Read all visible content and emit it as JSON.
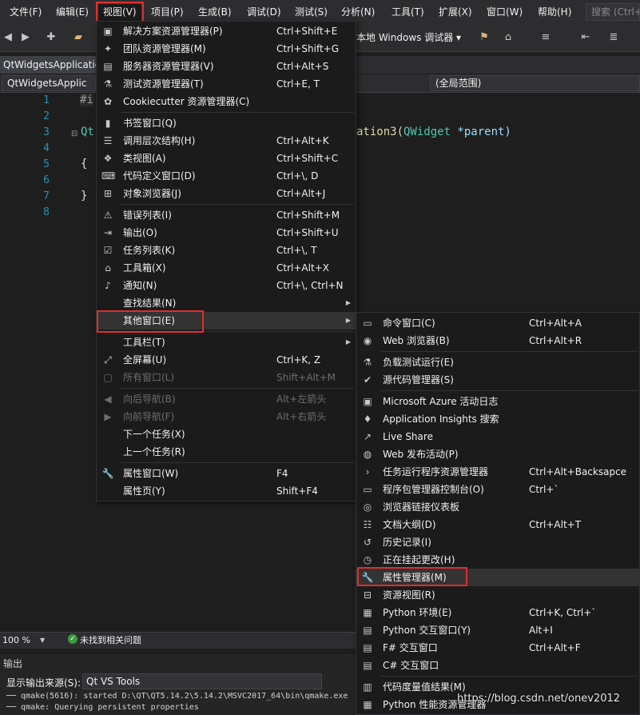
{
  "menubar": {
    "items": [
      "文件(F)",
      "编辑(E)",
      "视图(V)",
      "项目(P)",
      "生成(B)",
      "调试(D)",
      "测试(S)",
      "分析(N)",
      "工具(T)",
      "扩展(X)",
      "窗口(W)",
      "帮助(H)"
    ],
    "search_placeholder": "搜索 (Ctrl+"
  },
  "toolbar": {
    "debugger": "本地 Windows 调试器 ▾"
  },
  "tabs": {
    "doc": "QtWidgetsApplication",
    "nav_left": "QtWidgetsApplic",
    "nav_right": "(全局范围)"
  },
  "editor": {
    "lines": [
      "1",
      "2",
      "3",
      "4",
      "5",
      "6",
      "7",
      "8"
    ],
    "code": {
      "l1": "#i",
      "l3a": "Qt",
      "l3b": "ation3(",
      "l3type": "QWidget",
      "l3c": " *parent)",
      "l5": "{",
      "l7": "}"
    }
  },
  "status": {
    "zoom": "100 %",
    "issues": "未找到相关问题"
  },
  "output": {
    "title": "输出",
    "source_label": "显示输出来源(S):",
    "source_value": "Qt VS Tools",
    "lines": [
      "── qmake(5616): started D:\\QT\\QT5.14.2\\5.14.2\\MSVC2017_64\\bin\\qmake.exe",
      "── qmake: Querying persistent properties"
    ]
  },
  "view_menu": {
    "groups": [
      [
        {
          "icon": "solution-explorer-icon",
          "glyph": "▣",
          "label": "解决方案资源管理器(P)",
          "shortcut": "Ctrl+Shift+E"
        },
        {
          "icon": "team-explorer-icon",
          "glyph": "✦",
          "label": "团队资源管理器(M)",
          "shortcut": "Ctrl+Shift+G"
        },
        {
          "icon": "server-explorer-icon",
          "glyph": "▤",
          "label": "服务器资源管理器(V)",
          "shortcut": "Ctrl+Alt+S"
        },
        {
          "icon": "test-explorer-icon",
          "glyph": "⚗",
          "label": "测试资源管理器(T)",
          "shortcut": "Ctrl+E, T"
        },
        {
          "icon": "cookiecutter-icon",
          "glyph": "✿",
          "label": "Cookiecutter 资源管理器(C)",
          "shortcut": ""
        }
      ],
      [
        {
          "icon": "bookmark-icon",
          "glyph": "▮",
          "label": "书签窗口(Q)",
          "shortcut": ""
        },
        {
          "icon": "call-hierarchy-icon",
          "glyph": "☰",
          "label": "调用层次结构(H)",
          "shortcut": "Ctrl+Alt+K"
        },
        {
          "icon": "class-view-icon",
          "glyph": "❖",
          "label": "类视图(A)",
          "shortcut": "Ctrl+Shift+C"
        },
        {
          "icon": "code-definition-icon",
          "glyph": "⌨",
          "label": "代码定义窗口(D)",
          "shortcut": "Ctrl+\\, D"
        },
        {
          "icon": "object-browser-icon",
          "glyph": "⊞",
          "label": "对象浏览器(J)",
          "shortcut": "Ctrl+Alt+J"
        }
      ],
      [
        {
          "icon": "error-list-icon",
          "glyph": "⚠",
          "label": "错误列表(I)",
          "shortcut": "Ctrl+Shift+M"
        },
        {
          "icon": "output-icon",
          "glyph": "⇥",
          "label": "输出(O)",
          "shortcut": "Ctrl+Shift+U"
        },
        {
          "icon": "task-list-icon",
          "glyph": "☑",
          "label": "任务列表(K)",
          "shortcut": "Ctrl+\\, T"
        },
        {
          "icon": "toolbox-icon",
          "glyph": "⌂",
          "label": "工具箱(X)",
          "shortcut": "Ctrl+Alt+X"
        },
        {
          "icon": "bell-icon",
          "glyph": "♪",
          "label": "通知(N)",
          "shortcut": "Ctrl+\\, Ctrl+N"
        },
        {
          "icon": "none",
          "glyph": "",
          "label": "查找结果(N)",
          "shortcut": "",
          "submenu": true
        },
        {
          "icon": "none",
          "glyph": "",
          "label": "其他窗口(E)",
          "shortcut": "",
          "submenu": true,
          "hot": true
        }
      ],
      [
        {
          "icon": "none",
          "glyph": "",
          "label": "工具栏(T)",
          "shortcut": "",
          "submenu": true
        },
        {
          "icon": "full-screen-icon",
          "glyph": "⤢",
          "label": "全屏幕(U)",
          "shortcut": "Ctrl+K, Z"
        },
        {
          "icon": "all-windows-icon",
          "glyph": "▢",
          "label": "所有窗口(L)",
          "shortcut": "Shift+Alt+M",
          "disabled": true
        }
      ],
      [
        {
          "icon": "back-arrow-icon",
          "glyph": "◀",
          "label": "向后导航(B)",
          "shortcut": "Alt+左箭头",
          "disabled": true
        },
        {
          "icon": "forward-arrow-icon",
          "glyph": "▶",
          "label": "向前导航(F)",
          "shortcut": "Alt+右箭头",
          "disabled": true
        },
        {
          "icon": "none",
          "glyph": "",
          "label": "下一个任务(X)",
          "shortcut": ""
        },
        {
          "icon": "none",
          "glyph": "",
          "label": "上一个任务(R)",
          "shortcut": ""
        }
      ],
      [
        {
          "icon": "wrench-icon",
          "glyph": "🔧",
          "label": "属性窗口(W)",
          "shortcut": "F4"
        },
        {
          "icon": "none",
          "glyph": "",
          "label": "属性页(Y)",
          "shortcut": "Shift+F4"
        }
      ]
    ]
  },
  "other_windows_menu": {
    "groups": [
      [
        {
          "icon": "command-window-icon",
          "glyph": "▭",
          "label": "命令窗口(C)",
          "shortcut": "Ctrl+Alt+A"
        },
        {
          "icon": "web-browser-icon",
          "glyph": "◉",
          "label": "Web 浏览器(B)",
          "shortcut": "Ctrl+Alt+R"
        }
      ],
      [
        {
          "icon": "load-test-icon",
          "glyph": "⚗",
          "label": "负载测试运行(E)",
          "shortcut": ""
        },
        {
          "icon": "source-control-icon",
          "glyph": "✔",
          "label": "源代码管理器(S)",
          "shortcut": ""
        }
      ],
      [
        {
          "icon": "azure-log-icon",
          "glyph": "▣",
          "label": "Microsoft Azure 活动日志",
          "shortcut": ""
        },
        {
          "icon": "insights-icon",
          "glyph": "♦",
          "label": "Application Insights 搜索",
          "shortcut": ""
        },
        {
          "icon": "live-share-icon",
          "glyph": "↗",
          "label": "Live Share",
          "shortcut": ""
        },
        {
          "icon": "web-publish-icon",
          "glyph": "◍",
          "label": "Web 发布活动(P)",
          "shortcut": ""
        },
        {
          "icon": "chevron-right-icon",
          "glyph": "›",
          "label": "任务运行程序资源管理器",
          "shortcut": "Ctrl+Alt+Backsapce"
        },
        {
          "icon": "package-console-icon",
          "glyph": "▭",
          "label": "程序包管理器控制台(O)",
          "shortcut": "Ctrl+`"
        },
        {
          "icon": "browser-link-icon",
          "glyph": "◎",
          "label": "浏览器链接仪表板",
          "shortcut": ""
        },
        {
          "icon": "document-outline-icon",
          "glyph": "☷",
          "label": "文档大纲(D)",
          "shortcut": "Ctrl+Alt+T"
        },
        {
          "icon": "history-icon",
          "glyph": "↺",
          "label": "历史记录(I)",
          "shortcut": ""
        },
        {
          "icon": "pending-changes-icon",
          "glyph": "◷",
          "label": "正在挂起更改(H)",
          "shortcut": ""
        },
        {
          "icon": "wrench-icon",
          "glyph": "🔧",
          "label": "属性管理器(M)",
          "shortcut": "",
          "hot": true
        },
        {
          "icon": "resource-view-icon",
          "glyph": "⊟",
          "label": "资源视图(R)",
          "shortcut": ""
        },
        {
          "icon": "python-env-icon",
          "glyph": "▦",
          "label": "Python 环境(E)",
          "shortcut": "Ctrl+K, Ctrl+`"
        },
        {
          "icon": "python-interactive-icon",
          "glyph": "▤",
          "label": "Python 交互窗口(Y)",
          "shortcut": "Alt+I"
        },
        {
          "icon": "fsharp-interactive-icon",
          "glyph": "▤",
          "label": "F# 交互窗口",
          "shortcut": "Ctrl+Alt+F"
        },
        {
          "icon": "csharp-interactive-icon",
          "glyph": "▤",
          "label": "C# 交互窗口",
          "shortcut": ""
        }
      ],
      [
        {
          "icon": "code-metrics-icon",
          "glyph": "▥",
          "label": "代码度量值结果(M)",
          "shortcut": ""
        },
        {
          "icon": "python-profiler-icon",
          "glyph": "▦",
          "label": "Python 性能资源管理器",
          "shortcut": ""
        }
      ]
    ]
  },
  "watermark": "https://blog.csdn.net/onev2012"
}
